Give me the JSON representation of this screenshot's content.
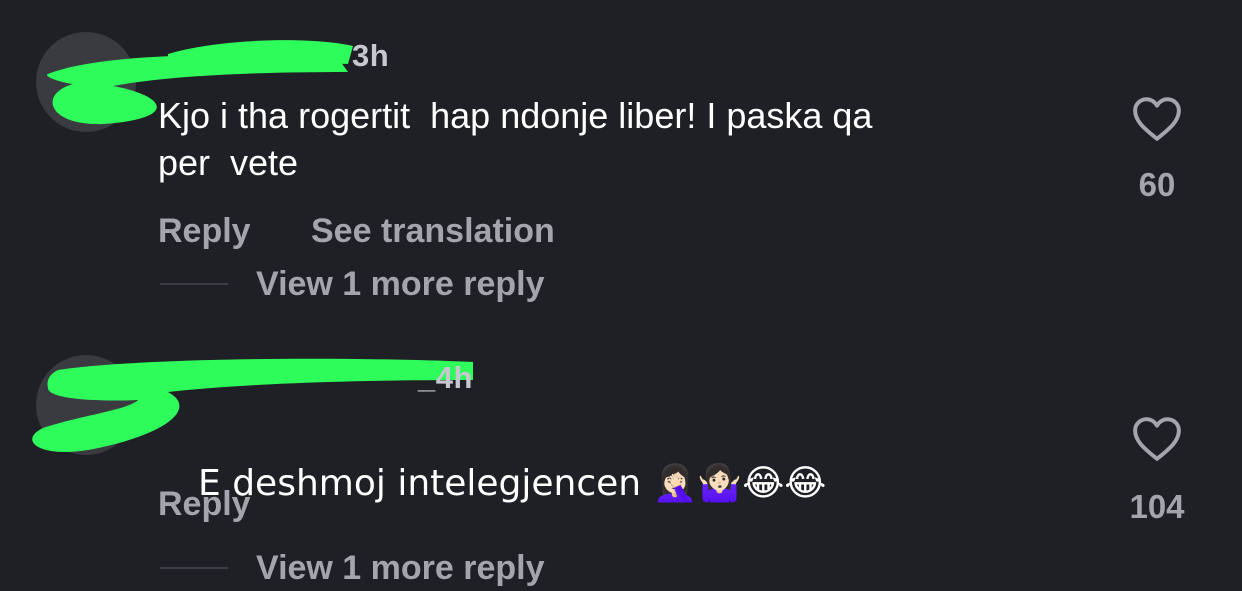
{
  "comments": [
    {
      "time": "3h",
      "text": "Kjo i tha rogertit  hap ndonje liber! I paska qa\nper  vete",
      "actions": {
        "reply": "Reply",
        "translate": "See translation"
      },
      "view_more": "View 1 more reply",
      "likes": "60"
    },
    {
      "time": "_4h",
      "text": "E deshmoj intelegjencen 🤦🏻‍♀️🤷🏻‍♀️😂😂",
      "actions": {
        "reply": "Reply"
      },
      "view_more": "View 1 more reply",
      "likes": "104"
    }
  ],
  "colors": {
    "background": "#1f2025",
    "text": "#ffffff",
    "secondary": "#a3a5ad",
    "redaction": "#2efc5b"
  },
  "icons": [
    "heart-icon"
  ]
}
